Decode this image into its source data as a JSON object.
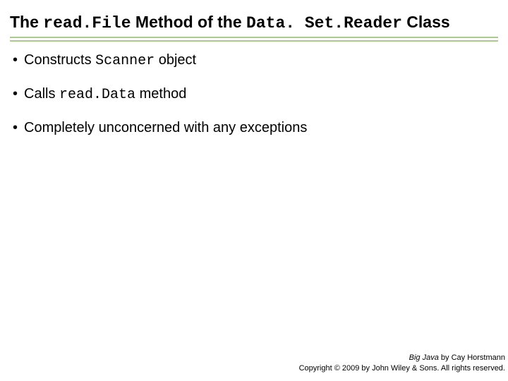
{
  "title": {
    "t1": "The ",
    "code1": "read.File",
    "t2": " Method of the ",
    "code2": "Data. Set.Reader",
    "t3": " Class"
  },
  "bullets": [
    {
      "pre": "Constructs ",
      "code": "Scanner",
      "post": " object"
    },
    {
      "pre": "Calls ",
      "code": "read.Data",
      "post": " method"
    },
    {
      "pre": "Completely unconcerned with any exceptions",
      "code": "",
      "post": ""
    }
  ],
  "footer": {
    "line1_italic": "Big Java",
    "line1_rest": " by Cay Horstmann",
    "line2": "Copyright © 2009 by John Wiley & Sons.  All rights reserved."
  }
}
